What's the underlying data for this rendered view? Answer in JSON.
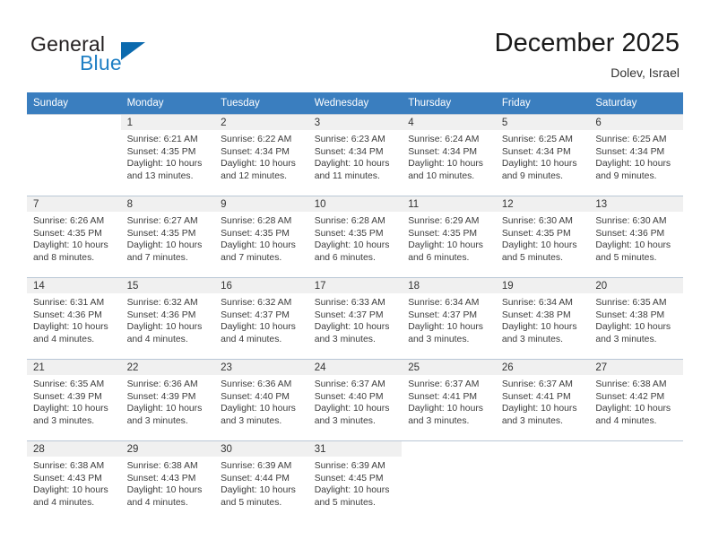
{
  "brand": {
    "word_one": "General",
    "word_two": "Blue",
    "triangle_icon": "triangle-icon"
  },
  "header": {
    "month_title": "December 2025",
    "location": "Dolev, Israel"
  },
  "calendar": {
    "weekday_headers": [
      "Sunday",
      "Monday",
      "Tuesday",
      "Wednesday",
      "Thursday",
      "Friday",
      "Saturday"
    ],
    "header_bg": "#3a7ebf",
    "daynum_bg": "#f0f0f0",
    "grid_line": "#b9c7d6",
    "weeks": [
      [
        {
          "day": "",
          "sunrise": "",
          "sunset": "",
          "daylight_line1": "",
          "daylight_line2": ""
        },
        {
          "day": "1",
          "sunrise": "Sunrise: 6:21 AM",
          "sunset": "Sunset: 4:35 PM",
          "daylight_line1": "Daylight: 10 hours",
          "daylight_line2": "and 13 minutes."
        },
        {
          "day": "2",
          "sunrise": "Sunrise: 6:22 AM",
          "sunset": "Sunset: 4:34 PM",
          "daylight_line1": "Daylight: 10 hours",
          "daylight_line2": "and 12 minutes."
        },
        {
          "day": "3",
          "sunrise": "Sunrise: 6:23 AM",
          "sunset": "Sunset: 4:34 PM",
          "daylight_line1": "Daylight: 10 hours",
          "daylight_line2": "and 11 minutes."
        },
        {
          "day": "4",
          "sunrise": "Sunrise: 6:24 AM",
          "sunset": "Sunset: 4:34 PM",
          "daylight_line1": "Daylight: 10 hours",
          "daylight_line2": "and 10 minutes."
        },
        {
          "day": "5",
          "sunrise": "Sunrise: 6:25 AM",
          "sunset": "Sunset: 4:34 PM",
          "daylight_line1": "Daylight: 10 hours",
          "daylight_line2": "and 9 minutes."
        },
        {
          "day": "6",
          "sunrise": "Sunrise: 6:25 AM",
          "sunset": "Sunset: 4:34 PM",
          "daylight_line1": "Daylight: 10 hours",
          "daylight_line2": "and 9 minutes."
        }
      ],
      [
        {
          "day": "7",
          "sunrise": "Sunrise: 6:26 AM",
          "sunset": "Sunset: 4:35 PM",
          "daylight_line1": "Daylight: 10 hours",
          "daylight_line2": "and 8 minutes."
        },
        {
          "day": "8",
          "sunrise": "Sunrise: 6:27 AM",
          "sunset": "Sunset: 4:35 PM",
          "daylight_line1": "Daylight: 10 hours",
          "daylight_line2": "and 7 minutes."
        },
        {
          "day": "9",
          "sunrise": "Sunrise: 6:28 AM",
          "sunset": "Sunset: 4:35 PM",
          "daylight_line1": "Daylight: 10 hours",
          "daylight_line2": "and 7 minutes."
        },
        {
          "day": "10",
          "sunrise": "Sunrise: 6:28 AM",
          "sunset": "Sunset: 4:35 PM",
          "daylight_line1": "Daylight: 10 hours",
          "daylight_line2": "and 6 minutes."
        },
        {
          "day": "11",
          "sunrise": "Sunrise: 6:29 AM",
          "sunset": "Sunset: 4:35 PM",
          "daylight_line1": "Daylight: 10 hours",
          "daylight_line2": "and 6 minutes."
        },
        {
          "day": "12",
          "sunrise": "Sunrise: 6:30 AM",
          "sunset": "Sunset: 4:35 PM",
          "daylight_line1": "Daylight: 10 hours",
          "daylight_line2": "and 5 minutes."
        },
        {
          "day": "13",
          "sunrise": "Sunrise: 6:30 AM",
          "sunset": "Sunset: 4:36 PM",
          "daylight_line1": "Daylight: 10 hours",
          "daylight_line2": "and 5 minutes."
        }
      ],
      [
        {
          "day": "14",
          "sunrise": "Sunrise: 6:31 AM",
          "sunset": "Sunset: 4:36 PM",
          "daylight_line1": "Daylight: 10 hours",
          "daylight_line2": "and 4 minutes."
        },
        {
          "day": "15",
          "sunrise": "Sunrise: 6:32 AM",
          "sunset": "Sunset: 4:36 PM",
          "daylight_line1": "Daylight: 10 hours",
          "daylight_line2": "and 4 minutes."
        },
        {
          "day": "16",
          "sunrise": "Sunrise: 6:32 AM",
          "sunset": "Sunset: 4:37 PM",
          "daylight_line1": "Daylight: 10 hours",
          "daylight_line2": "and 4 minutes."
        },
        {
          "day": "17",
          "sunrise": "Sunrise: 6:33 AM",
          "sunset": "Sunset: 4:37 PM",
          "daylight_line1": "Daylight: 10 hours",
          "daylight_line2": "and 3 minutes."
        },
        {
          "day": "18",
          "sunrise": "Sunrise: 6:34 AM",
          "sunset": "Sunset: 4:37 PM",
          "daylight_line1": "Daylight: 10 hours",
          "daylight_line2": "and 3 minutes."
        },
        {
          "day": "19",
          "sunrise": "Sunrise: 6:34 AM",
          "sunset": "Sunset: 4:38 PM",
          "daylight_line1": "Daylight: 10 hours",
          "daylight_line2": "and 3 minutes."
        },
        {
          "day": "20",
          "sunrise": "Sunrise: 6:35 AM",
          "sunset": "Sunset: 4:38 PM",
          "daylight_line1": "Daylight: 10 hours",
          "daylight_line2": "and 3 minutes."
        }
      ],
      [
        {
          "day": "21",
          "sunrise": "Sunrise: 6:35 AM",
          "sunset": "Sunset: 4:39 PM",
          "daylight_line1": "Daylight: 10 hours",
          "daylight_line2": "and 3 minutes."
        },
        {
          "day": "22",
          "sunrise": "Sunrise: 6:36 AM",
          "sunset": "Sunset: 4:39 PM",
          "daylight_line1": "Daylight: 10 hours",
          "daylight_line2": "and 3 minutes."
        },
        {
          "day": "23",
          "sunrise": "Sunrise: 6:36 AM",
          "sunset": "Sunset: 4:40 PM",
          "daylight_line1": "Daylight: 10 hours",
          "daylight_line2": "and 3 minutes."
        },
        {
          "day": "24",
          "sunrise": "Sunrise: 6:37 AM",
          "sunset": "Sunset: 4:40 PM",
          "daylight_line1": "Daylight: 10 hours",
          "daylight_line2": "and 3 minutes."
        },
        {
          "day": "25",
          "sunrise": "Sunrise: 6:37 AM",
          "sunset": "Sunset: 4:41 PM",
          "daylight_line1": "Daylight: 10 hours",
          "daylight_line2": "and 3 minutes."
        },
        {
          "day": "26",
          "sunrise": "Sunrise: 6:37 AM",
          "sunset": "Sunset: 4:41 PM",
          "daylight_line1": "Daylight: 10 hours",
          "daylight_line2": "and 3 minutes."
        },
        {
          "day": "27",
          "sunrise": "Sunrise: 6:38 AM",
          "sunset": "Sunset: 4:42 PM",
          "daylight_line1": "Daylight: 10 hours",
          "daylight_line2": "and 4 minutes."
        }
      ],
      [
        {
          "day": "28",
          "sunrise": "Sunrise: 6:38 AM",
          "sunset": "Sunset: 4:43 PM",
          "daylight_line1": "Daylight: 10 hours",
          "daylight_line2": "and 4 minutes."
        },
        {
          "day": "29",
          "sunrise": "Sunrise: 6:38 AM",
          "sunset": "Sunset: 4:43 PM",
          "daylight_line1": "Daylight: 10 hours",
          "daylight_line2": "and 4 minutes."
        },
        {
          "day": "30",
          "sunrise": "Sunrise: 6:39 AM",
          "sunset": "Sunset: 4:44 PM",
          "daylight_line1": "Daylight: 10 hours",
          "daylight_line2": "and 5 minutes."
        },
        {
          "day": "31",
          "sunrise": "Sunrise: 6:39 AM",
          "sunset": "Sunset: 4:45 PM",
          "daylight_line1": "Daylight: 10 hours",
          "daylight_line2": "and 5 minutes."
        },
        {
          "day": "",
          "sunrise": "",
          "sunset": "",
          "daylight_line1": "",
          "daylight_line2": ""
        },
        {
          "day": "",
          "sunrise": "",
          "sunset": "",
          "daylight_line1": "",
          "daylight_line2": ""
        },
        {
          "day": "",
          "sunrise": "",
          "sunset": "",
          "daylight_line1": "",
          "daylight_line2": ""
        }
      ]
    ]
  }
}
